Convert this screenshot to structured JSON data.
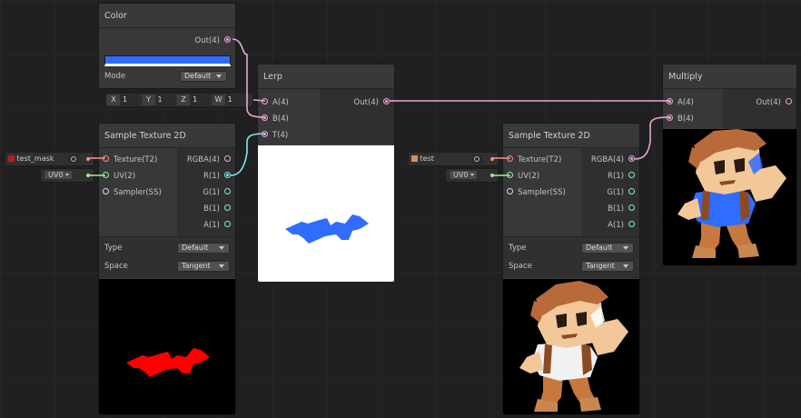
{
  "colors": {
    "accent_blue": "#2f6cff",
    "mask_red": "#ff0000",
    "wire_vector4": "#e8a6d8",
    "wire_vector1": "#84e4e7",
    "wire_vector2": "#9aef92",
    "wire_texture": "#ff8b8b"
  },
  "color_node": {
    "title": "Color",
    "out_label": "Out(4)",
    "mode_label": "Mode",
    "mode_value": "Default"
  },
  "vector_input": {
    "x_label": "X",
    "x_value": "1",
    "y_label": "Y",
    "y_value": "1",
    "z_label": "Z",
    "z_value": "1",
    "w_label": "W",
    "w_value": "1"
  },
  "lerp_node": {
    "title": "Lerp",
    "inputs": [
      "A(4)",
      "B(4)",
      "T(4)"
    ],
    "out_label": "Out(4)"
  },
  "sample_texture_1": {
    "title": "Sample Texture 2D",
    "texture_input_name": "test_mask",
    "uv_input_name": "UV0",
    "inputs": [
      "Texture(T2)",
      "UV(2)",
      "Sampler(SS)"
    ],
    "outputs": [
      "RGBA(4)",
      "R(1)",
      "G(1)",
      "B(1)",
      "A(1)"
    ],
    "type_label": "Type",
    "type_value": "Default",
    "space_label": "Space",
    "space_value": "Tangent"
  },
  "sample_texture_2": {
    "title": "Sample Texture 2D",
    "texture_input_name": "test",
    "uv_input_name": "UV0",
    "inputs": [
      "Texture(T2)",
      "UV(2)",
      "Sampler(SS)"
    ],
    "outputs": [
      "RGBA(4)",
      "R(1)",
      "G(1)",
      "B(1)",
      "A(1)"
    ],
    "type_label": "Type",
    "type_value": "Default",
    "space_label": "Space",
    "space_value": "Tangent"
  },
  "multiply_node": {
    "title": "Multiply",
    "inputs": [
      "A(4)",
      "B(4)"
    ],
    "out_label": "Out(4)"
  }
}
